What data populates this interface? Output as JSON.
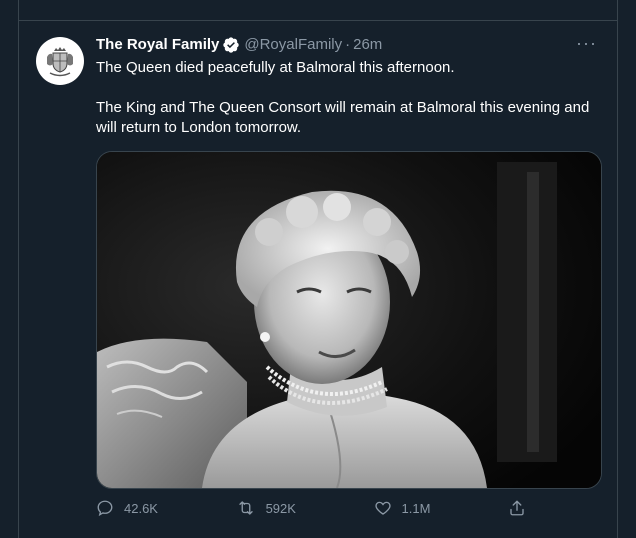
{
  "tweet": {
    "display_name": "The Royal Family",
    "handle": "@RoyalFamily",
    "separator": "·",
    "time": "26m",
    "more_label": "···",
    "text_line_1": "The Queen died peacefully at Balmoral this afternoon.",
    "text_line_2": "The King and The Queen Consort will remain at Balmoral this evening and will return to London tomorrow.",
    "media_alt": "Black and white portrait photograph"
  },
  "actions": {
    "reply_count": "42.6K",
    "retweet_count": "592K",
    "like_count": "1.1M"
  },
  "icons": {
    "reply": "reply-icon",
    "retweet": "retweet-icon",
    "like": "heart-icon",
    "share": "share-icon",
    "verified": "verified-badge-icon",
    "more": "more-icon"
  },
  "colors": {
    "background": "#15202b",
    "border": "#38444d",
    "secondary_text": "#8b98a5",
    "verified_badge": "#ffffff"
  }
}
